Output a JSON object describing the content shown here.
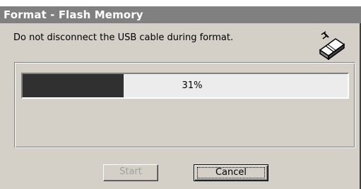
{
  "window": {
    "title": "Format - Flash Memory"
  },
  "dialog": {
    "message": "Do not disconnect the USB cable during format.",
    "icon": "eraser-icon"
  },
  "progress": {
    "fraction": 0.31,
    "label": "31%"
  },
  "buttons": {
    "start_label": "Start",
    "cancel_label": "Cancel"
  },
  "colors": {
    "titlebar": "#808080",
    "dialog_bg": "#d4d0c8",
    "progress_fill": "#303030"
  }
}
